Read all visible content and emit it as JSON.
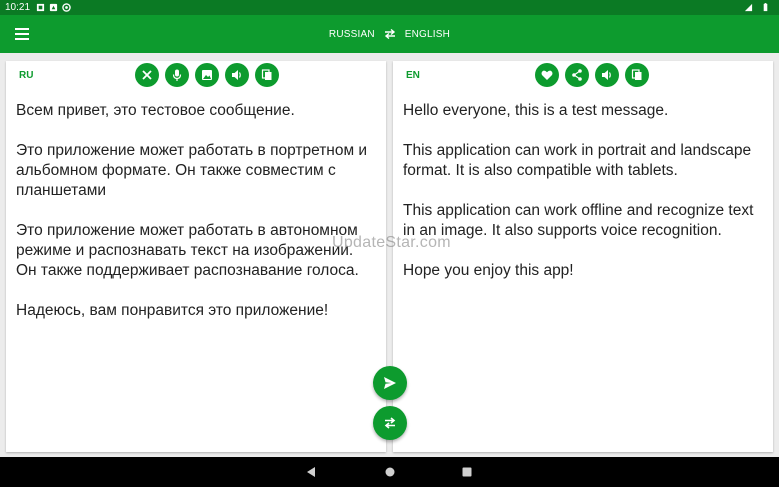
{
  "status": {
    "time": "10:21",
    "icons": [
      "notification-icon",
      "app-icon",
      "sync-icon"
    ],
    "signal": "signal-icon",
    "battery": "battery-icon"
  },
  "appbar": {
    "menu_icon": "hamburger-menu-icon",
    "source_lang": "RUSSIAN",
    "target_lang": "ENGLISH",
    "swap_icon": "swap-arrows-icon"
  },
  "source": {
    "code": "RU",
    "actions": [
      "clear-icon",
      "mic-icon",
      "image-icon",
      "speaker-icon",
      "copy-icon"
    ],
    "paragraphs": [
      "Всем привет, это тестовое сообщение.",
      "Это приложение может работать в портретном и альбомном формате. Он также совместим с планшетами",
      "Это приложение может работать в автономном режиме и распознавать текст на изображении. Он также поддерживает распознавание голоса.",
      "Надеюсь, вам понравится это приложение!"
    ]
  },
  "target": {
    "code": "EN",
    "actions": [
      "heart-icon",
      "share-icon",
      "speaker-icon",
      "copy-icon"
    ],
    "paragraphs": [
      "Hello everyone, this is a test message.",
      "This application can work in portrait and landscape format. It is also compatible with tablets.",
      "This application can work offline and recognize text in an image. It also supports voice recognition.",
      "Hope you enjoy this app!"
    ]
  },
  "watermark": "UpdateStar.com",
  "fabs": {
    "translate_icon": "send-icon",
    "swap_icon": "swap-icon"
  },
  "colors": {
    "primary": "#0d9b2e",
    "status": "#0b7a24",
    "background": "#ececec"
  }
}
